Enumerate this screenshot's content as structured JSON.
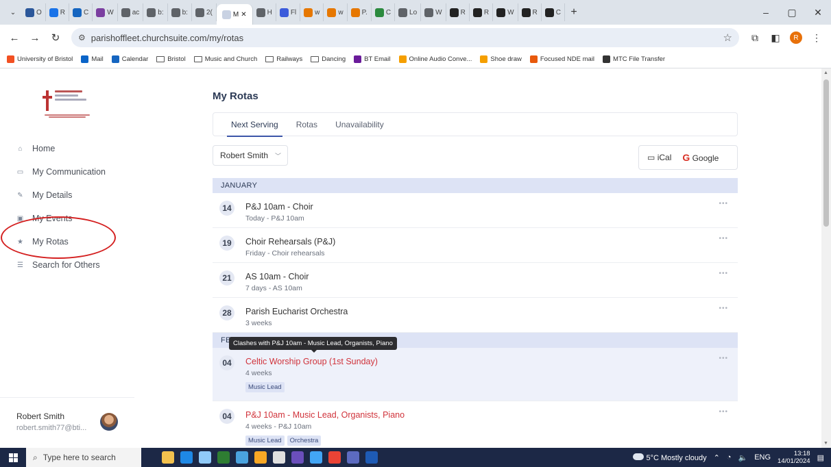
{
  "browser": {
    "tabs": [
      {
        "label": "O",
        "color": "#2b579a"
      },
      {
        "label": "R",
        "color": "#1a73e8"
      },
      {
        "label": "C",
        "color": "#1565c0"
      },
      {
        "label": "W",
        "color": "#7b3fa0"
      },
      {
        "label": "ac",
        "color": "#5f6368"
      },
      {
        "label": "b:",
        "color": "#5f6368"
      },
      {
        "label": "b:",
        "color": "#5f6368"
      },
      {
        "label": "2(",
        "color": "#5f6368"
      },
      {
        "label": "M",
        "color": "#ffffff",
        "active": true
      },
      {
        "label": "H",
        "color": "#5f6368"
      },
      {
        "label": "Fl",
        "color": "#3b5bdb"
      },
      {
        "label": "w",
        "color": "#e67700"
      },
      {
        "label": "w",
        "color": "#e67700"
      },
      {
        "label": "P.",
        "color": "#e67700"
      },
      {
        "label": "C",
        "color": "#2b8a3e"
      },
      {
        "label": "Lo",
        "color": "#5f6368"
      },
      {
        "label": "W",
        "color": "#5f6368"
      },
      {
        "label": "R",
        "color": "#222"
      },
      {
        "label": "R",
        "color": "#222"
      },
      {
        "label": "W",
        "color": "#222"
      },
      {
        "label": "R",
        "color": "#222"
      },
      {
        "label": "C",
        "color": "#222"
      }
    ],
    "url": "parishoffleet.churchsuite.com/my/rotas",
    "profile_initial": "R",
    "bookmarks": [
      {
        "label": "University of Bristol",
        "kind": "ms",
        "color": "#f25022"
      },
      {
        "label": "Mail",
        "kind": "outlook",
        "color": "#0a64c8"
      },
      {
        "label": "Calendar",
        "kind": "cal",
        "color": "#1565c0"
      },
      {
        "label": "Bristol",
        "kind": "folder"
      },
      {
        "label": "Music and Church",
        "kind": "folder"
      },
      {
        "label": "Railways",
        "kind": "folder"
      },
      {
        "label": "Dancing",
        "kind": "folder"
      },
      {
        "label": "BT Email",
        "kind": "bt",
        "color": "#6a1b9a"
      },
      {
        "label": "Online Audio Conve...",
        "kind": "audio",
        "color": "#f59f00"
      },
      {
        "label": "Shoe draw",
        "kind": "shoe",
        "color": "#f59f00"
      },
      {
        "label": "Focused NDE mail",
        "kind": "focus",
        "color": "#e8590c"
      },
      {
        "label": "MTC File Transfer",
        "kind": "mtc",
        "color": "#333"
      }
    ]
  },
  "sidebar": {
    "items": [
      {
        "label": "Home",
        "icon": "home-icon",
        "glyph": "⌂"
      },
      {
        "label": "My Communication",
        "icon": "chat-icon",
        "glyph": "▭"
      },
      {
        "label": "My Details",
        "icon": "pencil-icon",
        "glyph": "✎"
      },
      {
        "label": "My Events",
        "icon": "calendar-icon",
        "glyph": "▣"
      },
      {
        "label": "My Rotas",
        "icon": "star-icon",
        "glyph": "★"
      },
      {
        "label": "Search for Others",
        "icon": "people-icon",
        "glyph": "☰"
      }
    ],
    "user_name": "Robert Smith",
    "user_email": "robert.smith77@bti..."
  },
  "main": {
    "title": "My Rotas",
    "tabs": [
      "Next Serving",
      "Rotas",
      "Unavailability"
    ],
    "active_tab": 0,
    "person_select": "Robert Smith",
    "ical_label": "iCal",
    "google_label": "Google"
  },
  "months": [
    {
      "label": "JANUARY",
      "events": [
        {
          "day": "14",
          "title": "P&J 10am - Choir",
          "sub": "Today - P&J 10am",
          "clash": false,
          "chips": []
        },
        {
          "day": "19",
          "title": "Choir Rehearsals (P&J)",
          "sub": "Friday - Choir rehearsals",
          "clash": false,
          "chips": []
        },
        {
          "day": "21",
          "title": "AS 10am - Choir",
          "sub": "7 days - AS 10am",
          "clash": false,
          "chips": []
        },
        {
          "day": "28",
          "title": "Parish Eucharist Orchestra",
          "sub": "3 weeks",
          "clash": false,
          "chips": []
        }
      ]
    },
    {
      "label": "FE",
      "events": [
        {
          "day": "04",
          "title": "Celtic Worship Group (1st Sunday)",
          "sub": "4 weeks",
          "clash": true,
          "chips": [
            "Music Lead"
          ]
        },
        {
          "day": "04",
          "title": "P&J 10am - Music Lead, Organists, Piano",
          "sub": "4 weeks - P&J 10am",
          "clash": true,
          "chips": [
            "Music Lead",
            "Orchestra"
          ]
        }
      ]
    }
  ],
  "tooltip": "Clashes with P&J 10am - Music Lead, Organists, Piano",
  "taskbar": {
    "search_placeholder": "Type here to search",
    "apps": [
      "#f2c14e",
      "#1e88e5",
      "#90caf9",
      "#2e7d32",
      "#4aa3df",
      "#f9a825",
      "#e0e0e0",
      "#6b4fbb",
      "#42a5f5",
      "#ea4335",
      "#5c6bc0",
      "#1e5bb5"
    ],
    "weather": "5°C  Mostly cloudy",
    "lang": "ENG",
    "time": "13:18",
    "date": "14/01/2024"
  }
}
